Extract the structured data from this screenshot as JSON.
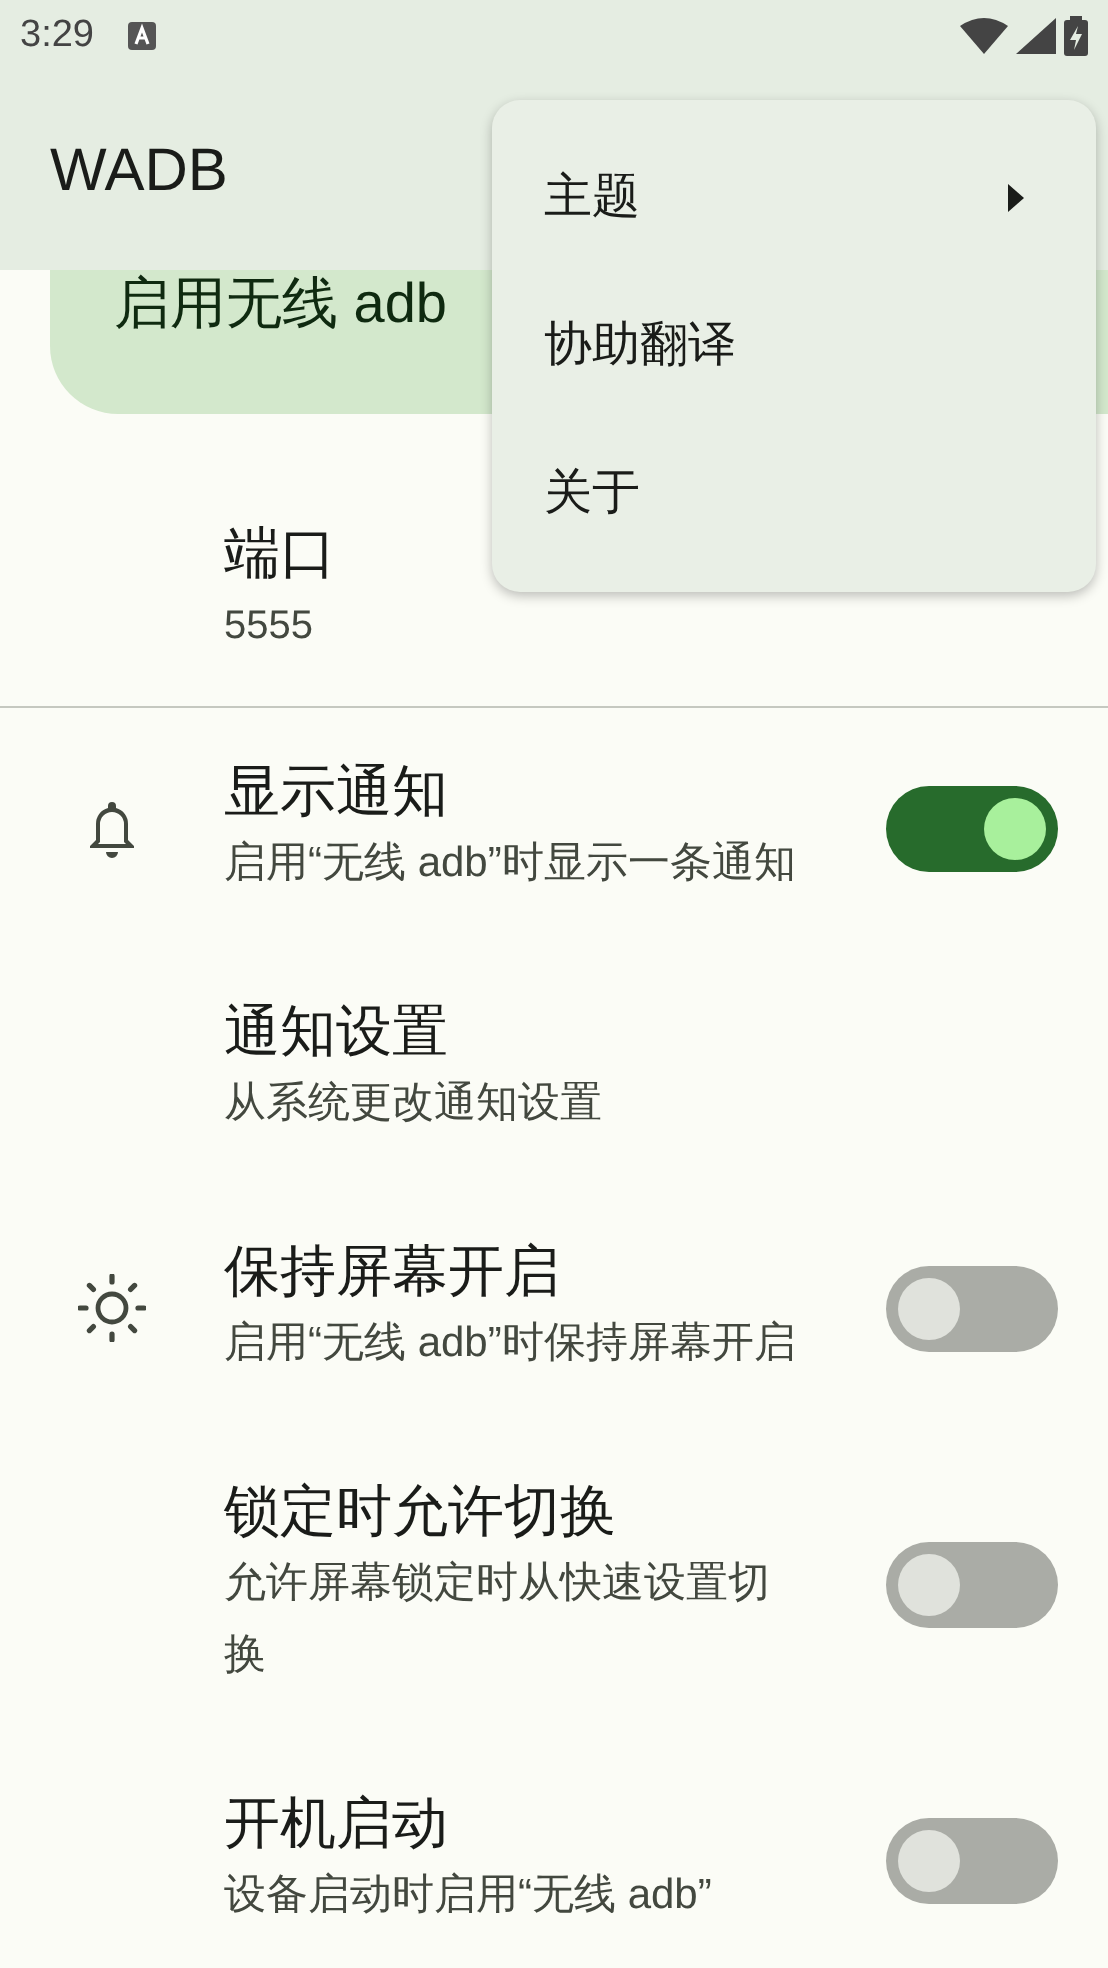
{
  "status_bar": {
    "time": "3:29"
  },
  "app_bar": {
    "title": "WADB"
  },
  "primary_switch": {
    "label": "启用无线 adb"
  },
  "port": {
    "title": "端口",
    "value": "5555"
  },
  "settings": [
    {
      "kind": "toggle",
      "title": "显示通知",
      "subtitle": "启用“无线 adb”时显示一条通知",
      "on": true
    },
    {
      "kind": "link",
      "title": "通知设置",
      "subtitle": "从系统更改通知设置"
    },
    {
      "kind": "toggle",
      "title": "保持屏幕开启",
      "subtitle": "启用“无线 adb”时保持屏幕开启",
      "on": false
    },
    {
      "kind": "toggle",
      "title": "锁定时允许切换",
      "subtitle": "允许屏幕锁定时从快速设置切换",
      "on": false
    },
    {
      "kind": "toggle",
      "title": "开机启动",
      "subtitle": "设备启动时启用“无线 adb”",
      "on": false
    }
  ],
  "menu": [
    {
      "label": "主题",
      "submenu": true
    },
    {
      "label": "协助翻译",
      "submenu": false
    },
    {
      "label": "关于",
      "submenu": false
    }
  ]
}
